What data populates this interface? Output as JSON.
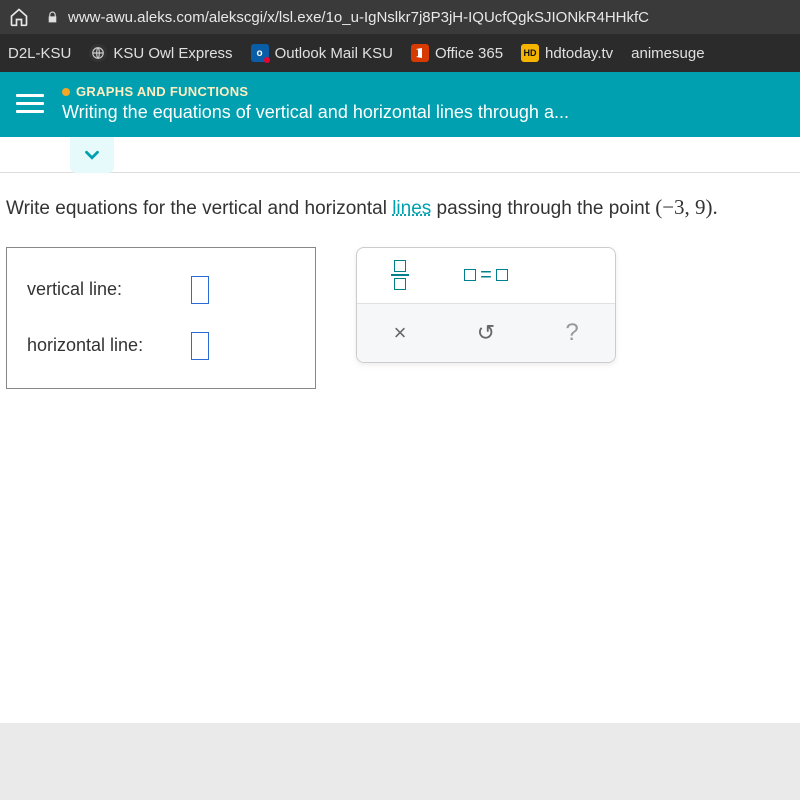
{
  "browser": {
    "url": "www-awu.aleks.com/alekscgi/x/lsl.exe/1o_u-IgNslkr7j8P3jH-IQUcfQgkSJIONkR4HHkfC"
  },
  "bookmarks": {
    "d2l": "D2L-KSU",
    "owl": "KSU Owl Express",
    "outlook": "Outlook Mail KSU",
    "office": "Office 365",
    "hd_badge": "HD",
    "hd": "hdtoday.tv",
    "anime": "animesuge"
  },
  "header": {
    "crumb": "GRAPHS AND FUNCTIONS",
    "title": "Writing the equations of vertical and horizontal lines through a..."
  },
  "question": {
    "pre": "Write equations for the vertical and horizontal ",
    "link": "lines",
    "post": " passing through the point ",
    "point": "(−3, 9)."
  },
  "answer": {
    "vertical_label": "vertical line:",
    "horizontal_label": "horizontal line:"
  },
  "tools": {
    "equals": "=",
    "clear": "×",
    "reset": "↺",
    "help": "?"
  }
}
